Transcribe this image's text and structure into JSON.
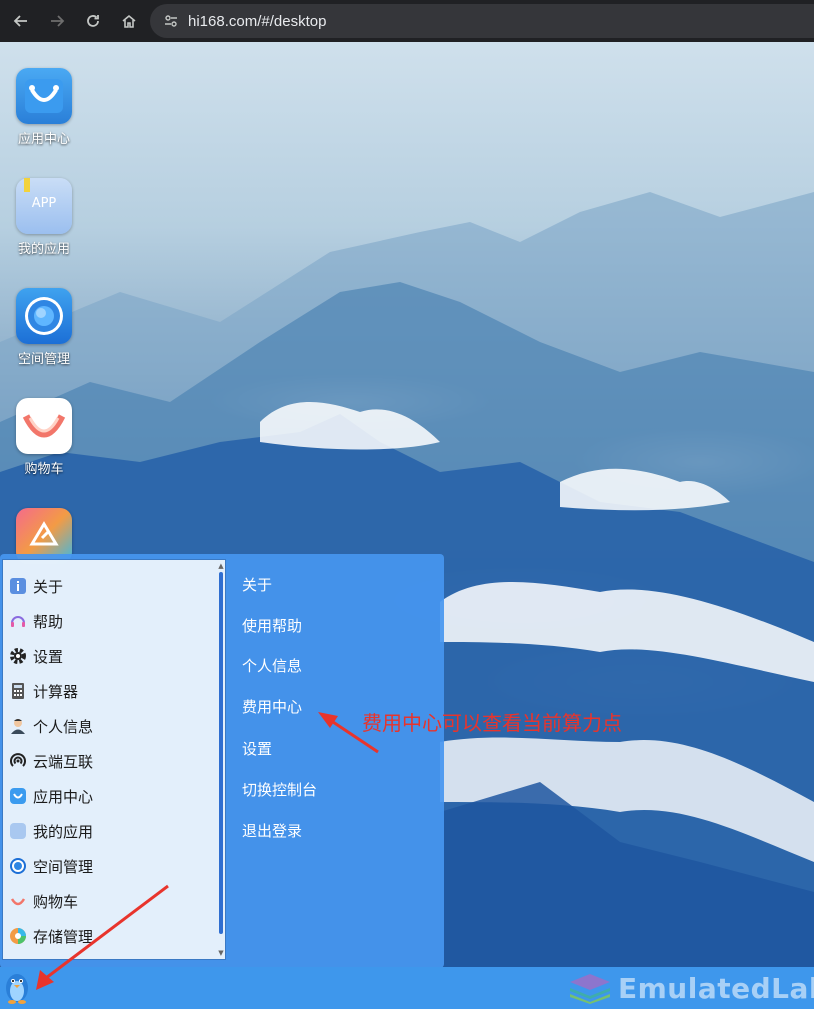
{
  "browser": {
    "url": "hi168.com/#/desktop",
    "icons": [
      "back-icon",
      "forward-icon",
      "reload-icon",
      "home-icon",
      "site-info-icon"
    ]
  },
  "desktop_icons": [
    {
      "label": "应用中心",
      "icon": "app-center-icon"
    },
    {
      "label": "我的应用",
      "icon": "my-apps-icon",
      "tile_text": "APP"
    },
    {
      "label": "空间管理",
      "icon": "space-management-icon"
    },
    {
      "label": "购物车",
      "icon": "shopping-cart-icon"
    }
  ],
  "start_menu": {
    "left_items": [
      {
        "label": "关于",
        "icon": "about-icon"
      },
      {
        "label": "帮助",
        "icon": "help-icon"
      },
      {
        "label": "设置",
        "icon": "settings-gear-icon"
      },
      {
        "label": "计算器",
        "icon": "calculator-icon"
      },
      {
        "label": "个人信息",
        "icon": "user-info-icon"
      },
      {
        "label": "云端互联",
        "icon": "cloud-connect-icon"
      },
      {
        "label": "应用中心",
        "icon": "app-center-icon"
      },
      {
        "label": "我的应用",
        "icon": "my-apps-icon"
      },
      {
        "label": "空间管理",
        "icon": "space-management-icon"
      },
      {
        "label": "购物车",
        "icon": "shopping-cart-icon"
      },
      {
        "label": "存储管理",
        "icon": "storage-management-icon"
      }
    ],
    "right_items": [
      {
        "label": "关于"
      },
      {
        "label": "使用帮助"
      },
      {
        "label": "个人信息"
      },
      {
        "label": "费用中心"
      },
      {
        "label": "设置"
      },
      {
        "label": "切换控制台"
      },
      {
        "label": "退出登录"
      }
    ]
  },
  "annotation": {
    "text": "费用中心可以查看当前算力点",
    "color": "#e8342c"
  },
  "watermark": {
    "text": "EmulatedLab"
  },
  "colors": {
    "taskbar": "#3e97ec",
    "menu": "#4696f0",
    "annotation_red": "#e8342c"
  }
}
